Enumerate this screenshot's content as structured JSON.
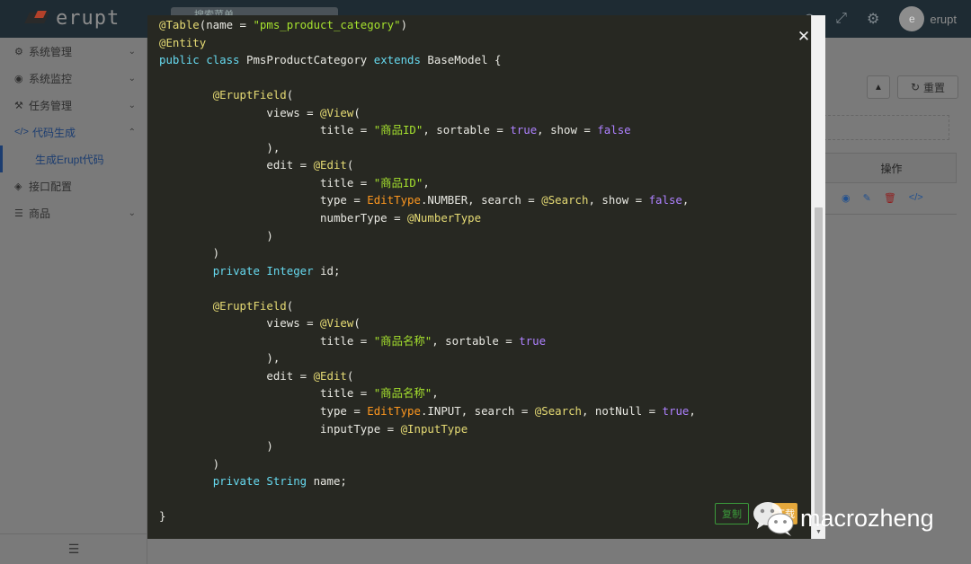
{
  "header": {
    "brand": "erupt",
    "search_placeholder": "搜索菜单",
    "user_initial": "e",
    "user_name": "erupt"
  },
  "sidebar": {
    "items": [
      {
        "label": "系统管理",
        "icon": "gears-icon",
        "expandable": true
      },
      {
        "label": "系统监控",
        "icon": "monitor-icon",
        "expandable": true
      },
      {
        "label": "任务管理",
        "icon": "tasks-icon",
        "expandable": true
      },
      {
        "label": "代码生成",
        "icon": "code-icon",
        "expandable": true,
        "active": true
      },
      {
        "label": "生成Erupt代码",
        "sub": true,
        "active": true
      },
      {
        "label": "接口配置",
        "icon": "cube-icon",
        "expandable": false
      },
      {
        "label": "商品",
        "icon": "list-icon",
        "expandable": true
      }
    ]
  },
  "background": {
    "reset_label": "重置",
    "actions_header": "操作"
  },
  "modal": {
    "copy_label": "复制",
    "download_label": "下载",
    "code_lines": [
      [
        [
          "c-ann",
          "@Table"
        ],
        [
          "c-id",
          "(name = "
        ],
        [
          "c-str",
          "\"pms_product_category\""
        ],
        [
          "c-id",
          ")"
        ]
      ],
      [
        [
          "c-ann",
          "@Entity"
        ]
      ],
      [
        [
          "c-kw",
          "public class "
        ],
        [
          "c-id",
          "PmsProductCategory "
        ],
        [
          "c-kw",
          "extends "
        ],
        [
          "c-id",
          "BaseModel {"
        ]
      ],
      [],
      [
        [
          "c-id",
          "        "
        ],
        [
          "c-ann",
          "@EruptField"
        ],
        [
          "c-id",
          "("
        ]
      ],
      [
        [
          "c-id",
          "                views = "
        ],
        [
          "c-ann",
          "@View"
        ],
        [
          "c-id",
          "("
        ]
      ],
      [
        [
          "c-id",
          "                        title = "
        ],
        [
          "c-str",
          "\"商品ID\""
        ],
        [
          "c-id",
          ", sortable = "
        ],
        [
          "c-bool",
          "true"
        ],
        [
          "c-id",
          ", show = "
        ],
        [
          "c-bool",
          "false"
        ]
      ],
      [
        [
          "c-id",
          "                ),"
        ]
      ],
      [
        [
          "c-id",
          "                edit = "
        ],
        [
          "c-ann",
          "@Edit"
        ],
        [
          "c-id",
          "("
        ]
      ],
      [
        [
          "c-id",
          "                        title = "
        ],
        [
          "c-str",
          "\"商品ID\""
        ],
        [
          "c-id",
          ","
        ]
      ],
      [
        [
          "c-id",
          "                        type = "
        ],
        [
          "c-ann2",
          "EditType"
        ],
        [
          "c-id",
          ".NUMBER, search = "
        ],
        [
          "c-ann",
          "@Search"
        ],
        [
          "c-id",
          ", show = "
        ],
        [
          "c-bool",
          "false"
        ],
        [
          "c-id",
          ","
        ]
      ],
      [
        [
          "c-id",
          "                        numberType = "
        ],
        [
          "c-ann",
          "@NumberType"
        ]
      ],
      [
        [
          "c-id",
          "                )"
        ]
      ],
      [
        [
          "c-id",
          "        )"
        ]
      ],
      [
        [
          "c-id",
          "        "
        ],
        [
          "c-kw",
          "private "
        ],
        [
          "c-type",
          "Integer "
        ],
        [
          "c-id",
          "id;"
        ]
      ],
      [],
      [
        [
          "c-id",
          "        "
        ],
        [
          "c-ann",
          "@EruptField"
        ],
        [
          "c-id",
          "("
        ]
      ],
      [
        [
          "c-id",
          "                views = "
        ],
        [
          "c-ann",
          "@View"
        ],
        [
          "c-id",
          "("
        ]
      ],
      [
        [
          "c-id",
          "                        title = "
        ],
        [
          "c-str",
          "\"商品名称\""
        ],
        [
          "c-id",
          ", sortable = "
        ],
        [
          "c-bool",
          "true"
        ]
      ],
      [
        [
          "c-id",
          "                ),"
        ]
      ],
      [
        [
          "c-id",
          "                edit = "
        ],
        [
          "c-ann",
          "@Edit"
        ],
        [
          "c-id",
          "("
        ]
      ],
      [
        [
          "c-id",
          "                        title = "
        ],
        [
          "c-str",
          "\"商品名称\""
        ],
        [
          "c-id",
          ","
        ]
      ],
      [
        [
          "c-id",
          "                        type = "
        ],
        [
          "c-ann2",
          "EditType"
        ],
        [
          "c-id",
          ".INPUT, search = "
        ],
        [
          "c-ann",
          "@Search"
        ],
        [
          "c-id",
          ", notNull = "
        ],
        [
          "c-bool",
          "true"
        ],
        [
          "c-id",
          ","
        ]
      ],
      [
        [
          "c-id",
          "                        inputType = "
        ],
        [
          "c-ann",
          "@InputType"
        ]
      ],
      [
        [
          "c-id",
          "                )"
        ]
      ],
      [
        [
          "c-id",
          "        )"
        ]
      ],
      [
        [
          "c-id",
          "        "
        ],
        [
          "c-kw",
          "private "
        ],
        [
          "c-type",
          "String "
        ],
        [
          "c-id",
          "name;"
        ]
      ],
      [],
      [
        [
          "c-id",
          "}"
        ]
      ]
    ]
  },
  "watermark": {
    "text": "macrozheng"
  },
  "colors": {
    "code_bg": "#272822",
    "annotation": "#e6db74",
    "keyword": "#66d9ef",
    "string": "#a6e22e",
    "boolean": "#ae81ff",
    "copy_green": "#3b9a3b",
    "download_orange": "#e5a83c"
  }
}
